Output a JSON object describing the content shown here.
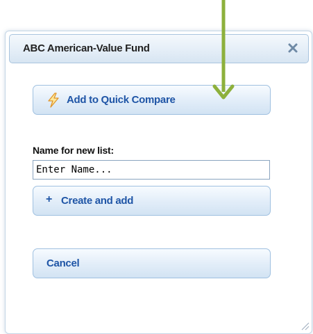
{
  "dialog": {
    "title": "ABC American-Value Fund",
    "close_icon": "close-icon"
  },
  "quick_compare": {
    "label": "Add to Quick Compare",
    "icon": "lightning-bolt-icon"
  },
  "new_list": {
    "label": "Name for new list:",
    "placeholder": "Enter Name...",
    "value": ""
  },
  "create_button": {
    "icon_glyph": "+",
    "label": "Create and add"
  },
  "cancel_button": {
    "label": "Cancel"
  },
  "colors": {
    "button_text": "#1f55a6",
    "annotation_arrow": "#8db03c",
    "border": "#9fc0e0"
  }
}
